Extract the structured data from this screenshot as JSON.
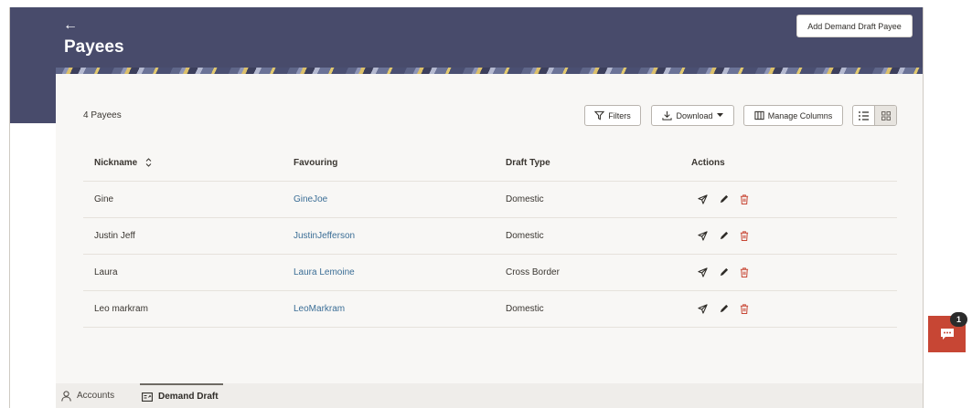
{
  "header": {
    "back_icon": "arrow-left-icon",
    "title": "Payees",
    "add_button_label": "Add Demand Draft Payee",
    "color": "#484b6b"
  },
  "toolbar": {
    "count_label": "4 Payees",
    "filters_label": "Filters",
    "download_label": "Download",
    "manage_columns_label": "Manage Columns",
    "view_toggle": {
      "list_icon": "list-view-icon",
      "grid_icon": "grid-view-icon",
      "active": "grid"
    }
  },
  "table": {
    "columns": [
      "Nickname",
      "Favouring",
      "Draft Type",
      "Actions"
    ],
    "sortable_column": "Nickname",
    "rows": [
      {
        "nickname": "Gine",
        "favouring": "GineJoe",
        "draft_type": "Domestic"
      },
      {
        "nickname": "Justin Jeff",
        "favouring": "JustinJefferson",
        "draft_type": "Domestic"
      },
      {
        "nickname": "Laura",
        "favouring": "Laura Lemoine",
        "draft_type": "Cross Border"
      },
      {
        "nickname": "Leo markram",
        "favouring": "LeoMarkram",
        "draft_type": "Domestic"
      }
    ],
    "row_actions": [
      "send-icon",
      "edit-pencil-icon",
      "delete-trash-icon"
    ]
  },
  "bottom_tabs": [
    {
      "label": "Accounts",
      "icon": "user-icon",
      "active": false
    },
    {
      "label": "Demand Draft",
      "icon": "demand-draft-icon",
      "active": true
    }
  ],
  "chat": {
    "badge_count": "1",
    "icon": "chat-bubble-icon",
    "color": "#c74634"
  },
  "colors": {
    "link": "#3b6e96",
    "delete": "#c74634",
    "card": "#f8f7f5"
  }
}
